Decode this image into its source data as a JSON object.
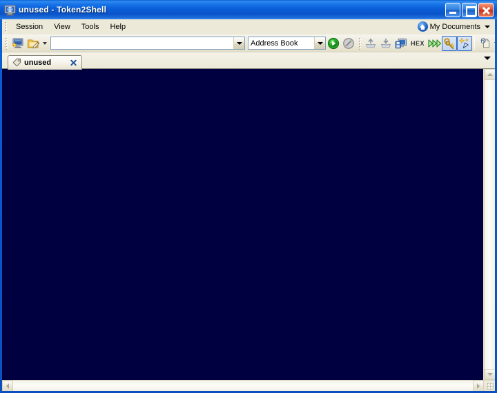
{
  "window": {
    "title": "unused - Token2Shell",
    "app_icon": "terminal-globe-icon",
    "buttons": {
      "minimize": "Minimize",
      "maximize": "Maximize",
      "close": "Close"
    }
  },
  "menubar": {
    "items": [
      {
        "label": "Session"
      },
      {
        "label": "View"
      },
      {
        "label": "Tools"
      },
      {
        "label": "Help"
      }
    ],
    "my_documents": {
      "label": "My Documents",
      "icon": "home-globe-icon",
      "caret": "chevron-down-icon"
    }
  },
  "toolbar": {
    "new_session_icon": "new-session-monitor-icon",
    "new_note_icon": "new-note-folder-pencil-icon",
    "new_note_caret": "chevron-down-icon",
    "address": {
      "value": "",
      "placeholder": "",
      "dropdown_icon": "chevron-down-icon"
    },
    "address_book": {
      "label": "Address Book",
      "dropdown_icon": "chevron-down-icon"
    },
    "connect_icon": "connect-play-icon",
    "disconnect_icon": "disconnect-stop-icon",
    "upload_icon": "upload-tray-icon",
    "download_icon": "download-tray-icon",
    "save_screen_icon": "save-screen-icon",
    "hex_label": "HEX",
    "fast_forward_icon": "fast-forward-icon",
    "keys_icon": "keys-icon",
    "wand_icon": "magic-wand-icon",
    "settings_icon": "settings-gear-document-icon",
    "settings_caret": "chevron-down-icon"
  },
  "tabs": {
    "items": [
      {
        "label": "unused",
        "icon": "tag-icon",
        "close_icon": "close-icon",
        "active": true
      }
    ],
    "overflow_icon": "chevron-down-icon"
  },
  "terminal": {
    "content": "",
    "background_color": "#000040"
  },
  "scrollbars": {
    "vertical": {
      "up_icon": "scroll-up-icon",
      "down_icon": "scroll-down-icon"
    },
    "horizontal": {
      "left_icon": "scroll-left-icon",
      "right_icon": "scroll-right-icon"
    },
    "resize_grip": "resize-grip-icon"
  },
  "colors": {
    "titlebar_blue": "#0a5fd4",
    "frame_blue": "#0a50c0",
    "chrome_beige": "#ece9d8",
    "terminal_bg": "#000040",
    "accent_green": "#22a522",
    "close_red": "#e2502c"
  }
}
